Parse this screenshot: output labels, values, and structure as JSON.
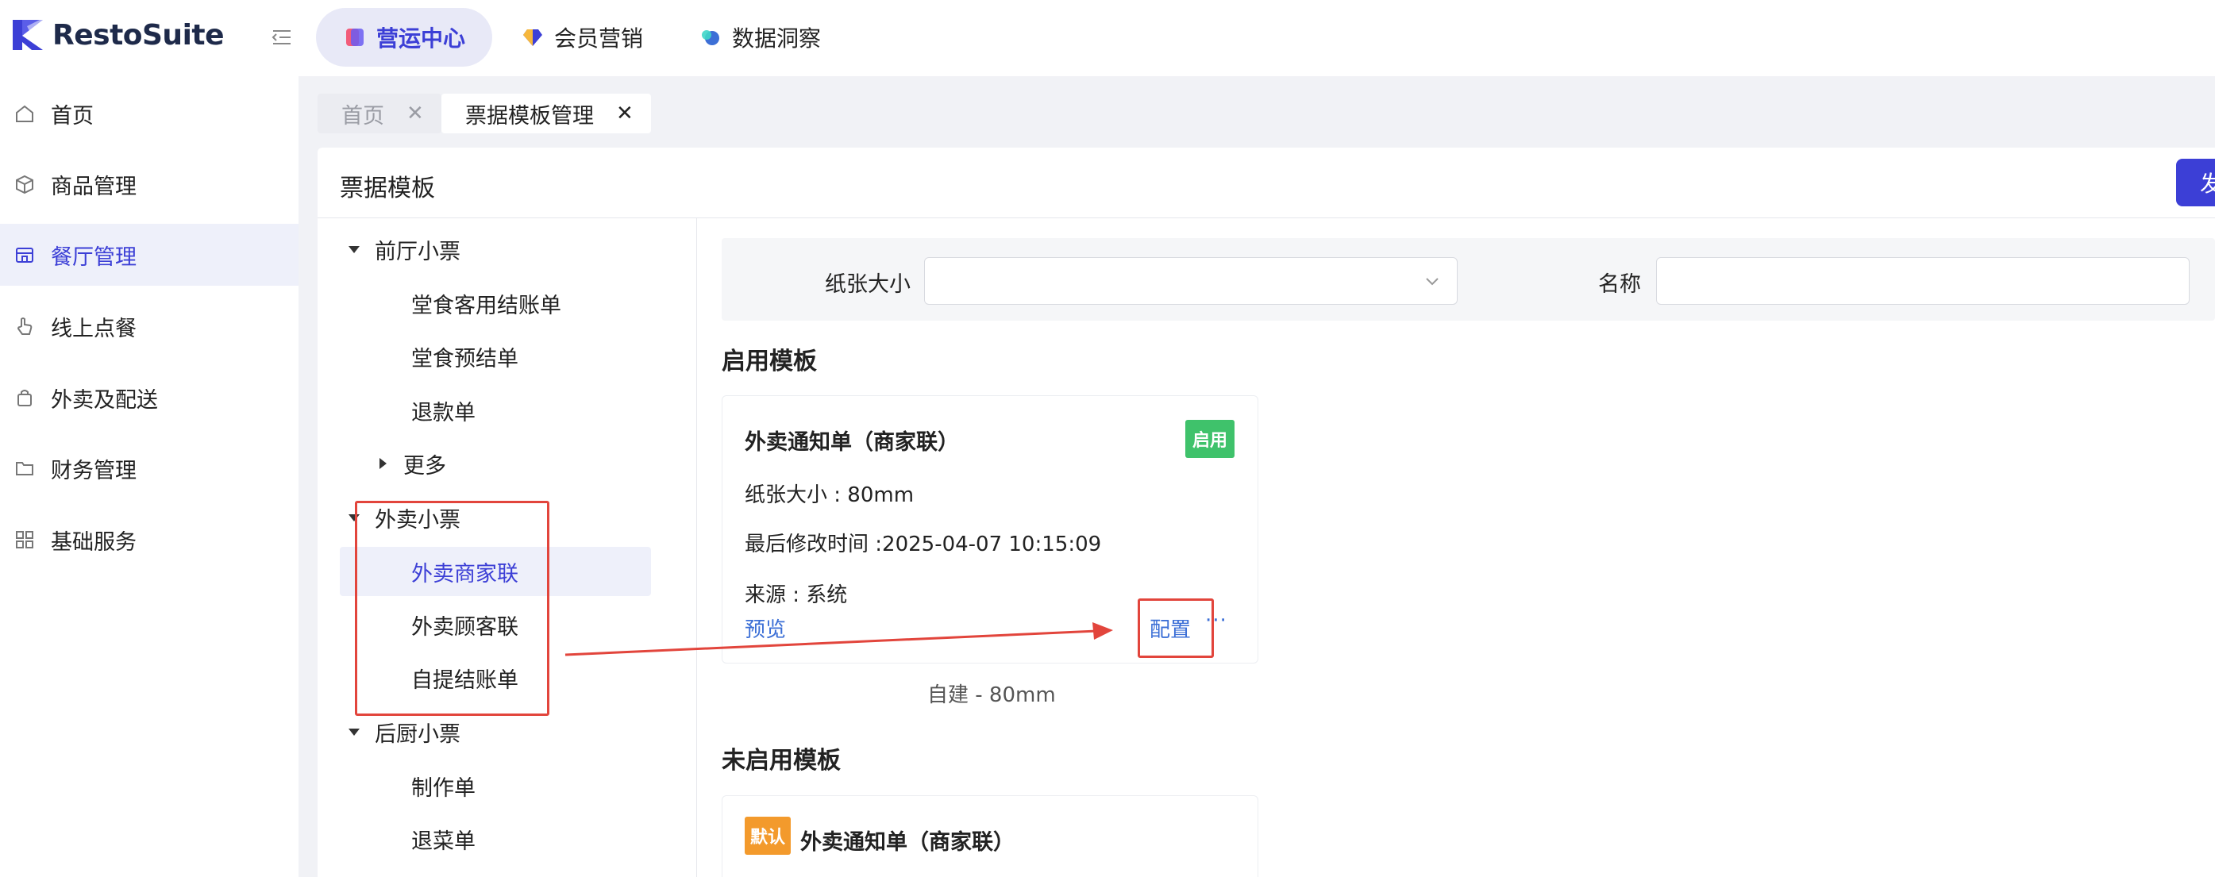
{
  "app": {
    "logo_text": "RestoSuite"
  },
  "top_tabs": [
    {
      "label": "营运中心",
      "active": true
    },
    {
      "label": "会员营销",
      "active": false
    },
    {
      "label": "数据洞察",
      "active": false
    }
  ],
  "sidebar": {
    "items": [
      {
        "label": "首页",
        "icon": "home-icon"
      },
      {
        "label": "商品管理",
        "icon": "box-icon"
      },
      {
        "label": "餐厅管理",
        "icon": "store-icon",
        "active": true
      },
      {
        "label": "线上点餐",
        "icon": "hand-pointer-icon"
      },
      {
        "label": "外卖及配送",
        "icon": "bag-icon"
      },
      {
        "label": "财务管理",
        "icon": "folder-icon"
      },
      {
        "label": "基础服务",
        "icon": "grid-icon"
      }
    ]
  },
  "page_tabs": [
    {
      "label": "首页",
      "close": "✕"
    },
    {
      "label": "票据模板管理",
      "close": "✕"
    }
  ],
  "panel": {
    "title": "票据模板",
    "publish_label": "发"
  },
  "tree": {
    "groups": [
      {
        "label": "前厅小票",
        "children": [
          "堂食客用结账单",
          "堂食预结单",
          "退款单"
        ],
        "more": "更多"
      },
      {
        "label": "外卖小票",
        "children": [
          "外卖商家联",
          "外卖顾客联",
          "自提结账单"
        ],
        "selected": "外卖商家联"
      },
      {
        "label": "后厨小票",
        "children": [
          "制作单",
          "退菜单"
        ]
      }
    ]
  },
  "filters": {
    "paper_size_label": "纸张大小",
    "paper_size_value": "",
    "name_label": "名称",
    "name_value": ""
  },
  "enabled_section": {
    "title": "启用模板",
    "card": {
      "title": "外卖通知单（商家联）",
      "badge": "启用",
      "paper_size": "纸张大小 : 80mm",
      "modified": "最后修改时间 :2025-04-07 10:15:09",
      "source": "来源 : 系统",
      "preview_label": "预览",
      "config_label": "配置",
      "more_label": "···",
      "caption": "自建 - 80mm"
    }
  },
  "disabled_section": {
    "title": "未启用模板",
    "card": {
      "badge": "默认",
      "title": "外卖通知单（商家联）"
    }
  },
  "colors": {
    "brand": "#3c3fd6",
    "annotation_red": "#e2453c",
    "badge_green": "#3fc26b",
    "badge_orange": "#f39a2c"
  }
}
